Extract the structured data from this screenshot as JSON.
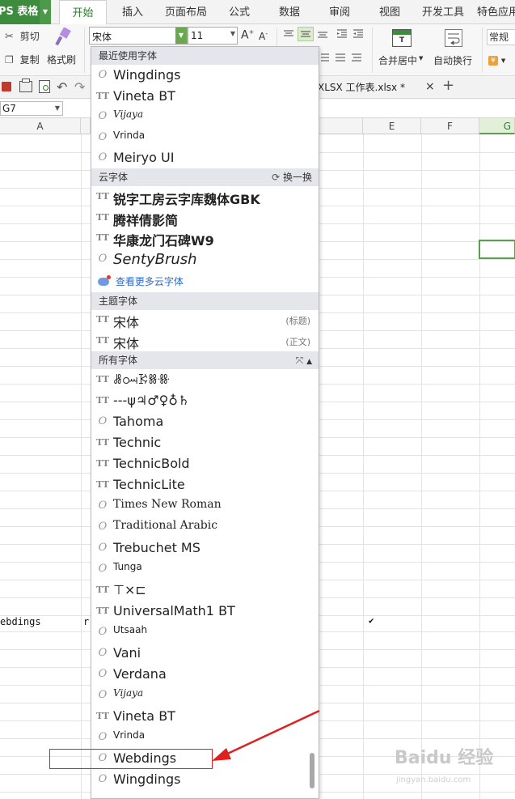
{
  "menubar": {
    "app_label": "PS 表格",
    "items": [
      {
        "label": "开始",
        "active": true
      },
      {
        "label": "插入"
      },
      {
        "label": "页面布局"
      },
      {
        "label": "公式"
      },
      {
        "label": "数据"
      },
      {
        "label": "审阅"
      },
      {
        "label": "视图"
      },
      {
        "label": "开发工具"
      },
      {
        "label": "特色应用"
      }
    ]
  },
  "ribbon": {
    "cut": "剪切",
    "copy": "复制",
    "format_painter": "格式刷",
    "font_name": "宋体",
    "font_size": "11",
    "grow_font": "A",
    "shrink_font": "A",
    "merge_center": "合并居中",
    "wrap_text": "自动换行",
    "number_format": "常规"
  },
  "toolrow": {
    "doc_tab": "XLSX 工作表.xlsx *",
    "close": "×",
    "new_tab": "+"
  },
  "namebox": {
    "value": "G7"
  },
  "columns": [
    "A",
    "E",
    "F",
    "G"
  ],
  "cells": {
    "a_row": "ebdings",
    "b_row": "r",
    "e_row": "✔"
  },
  "dropdown": {
    "recent_header": "最近使用字体",
    "recent": [
      {
        "name": "Wingdings",
        "kind": "o"
      },
      {
        "name": "Vineta BT",
        "kind": "t"
      },
      {
        "name": "Vijaya",
        "kind": "o"
      },
      {
        "name": "Vrinda",
        "kind": "o"
      },
      {
        "name": "Meiryo UI",
        "kind": "o"
      }
    ],
    "cloud_header": "云字体",
    "cloud_switch": "换一换",
    "cloud": [
      {
        "name": "锐字工房云字库魏体GBK",
        "kind": "t"
      },
      {
        "name": "腾祥倩影简",
        "kind": "t"
      },
      {
        "name": "华康龙门石碑W9",
        "kind": "t"
      },
      {
        "name": "SentyBrush",
        "kind": "o"
      }
    ],
    "cloud_more": "查看更多云字体",
    "theme_header": "主题字体",
    "theme": [
      {
        "name": "宋体",
        "kind": "t",
        "tag": "(标题)"
      },
      {
        "name": "宋体",
        "kind": "t",
        "tag": "(正文)"
      }
    ],
    "all_header": "所有字体",
    "all": [
      {
        "name": "ꗡꗢꗣꗤꗥ",
        "kind": "t"
      },
      {
        "name": "---ψ♃♂♀♁♄",
        "kind": "t"
      },
      {
        "name": "Tahoma",
        "kind": "o"
      },
      {
        "name": "Technic",
        "kind": "t"
      },
      {
        "name": "TechnicBold",
        "kind": "t"
      },
      {
        "name": "TechnicLite",
        "kind": "t"
      },
      {
        "name": "Times New Roman",
        "kind": "o"
      },
      {
        "name": "Traditional Arabic",
        "kind": "o"
      },
      {
        "name": "Trebuchet MS",
        "kind": "o"
      },
      {
        "name": "Tunga",
        "kind": "o"
      },
      {
        "name": "⊤×⊏",
        "kind": "t"
      },
      {
        "name": "UniversalMath1 BT",
        "kind": "t"
      },
      {
        "name": "Utsaah",
        "kind": "o"
      },
      {
        "name": "Vani",
        "kind": "o"
      },
      {
        "name": "Verdana",
        "kind": "o"
      },
      {
        "name": "Vijaya",
        "kind": "o"
      },
      {
        "name": "Vineta BT",
        "kind": "t"
      },
      {
        "name": "Vrinda",
        "kind": "o"
      },
      {
        "name": "Webdings",
        "kind": "o"
      },
      {
        "name": "Wingdings",
        "kind": "o"
      }
    ]
  },
  "watermark": {
    "main": "Baidu 经验",
    "sub": "jingyan.baidu.com"
  },
  "colors": {
    "brand_green": "#3d8b3d",
    "selection_green": "#5aa04a",
    "highlight_red": "#e02020"
  }
}
